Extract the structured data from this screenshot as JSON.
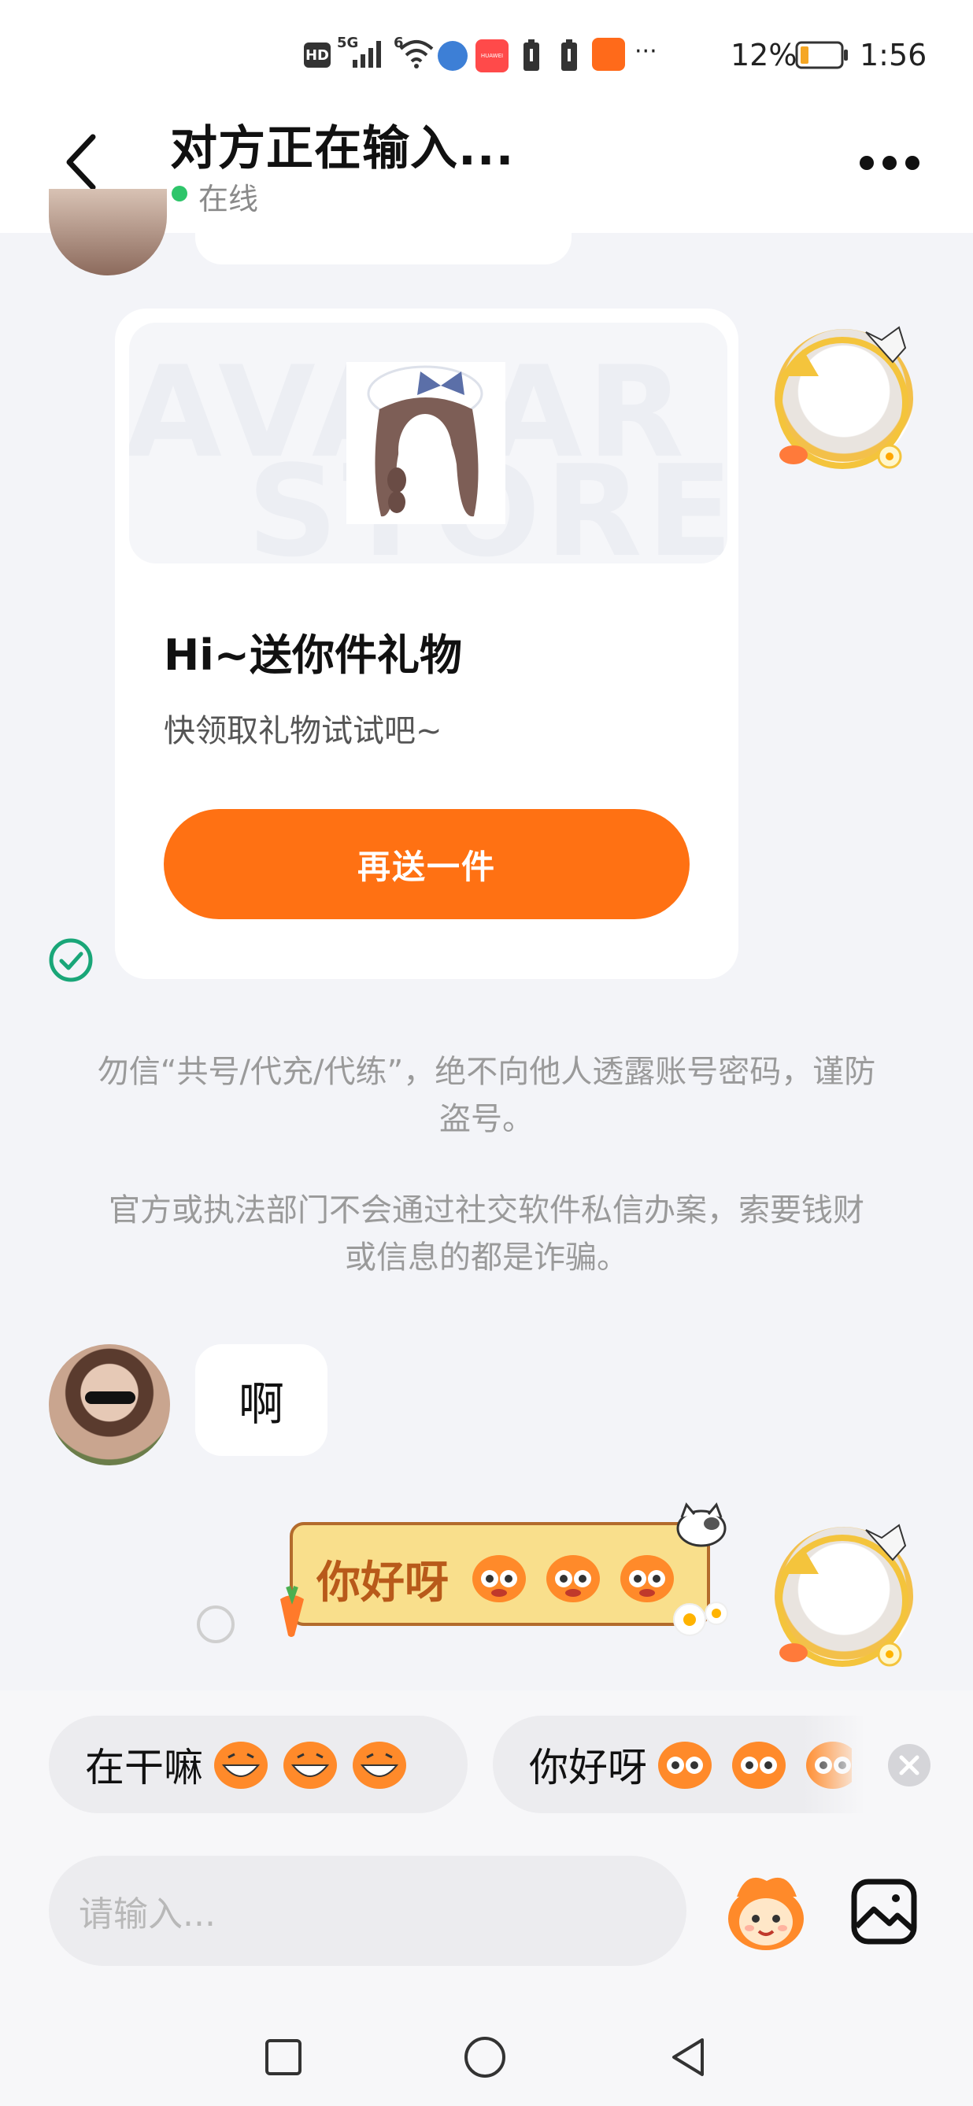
{
  "status_bar": {
    "hd": "HD",
    "network": "5G",
    "wifi_label": "6",
    "battery_percent": "12%",
    "time": "1:56",
    "more": "···",
    "app_badge": "HUAWEI"
  },
  "header": {
    "title": "对方正在输入...",
    "status": "在线"
  },
  "gift_card": {
    "banner_text_1": "AVATAR",
    "banner_text_2": "STORE",
    "title": "Hi~送你件礼物",
    "subtitle": "快领取礼物试试吧~",
    "button": "再送一件"
  },
  "notices": [
    "勿信“共号/代充/代练”，绝不向他人透露账号密码，谨防盗号。",
    "官方或执法部门不会通过社交软件私信办案，索要钱财或信息的都是诈骗。"
  ],
  "messages": {
    "incoming_text": "啊",
    "outgoing_sticker_text": "你好呀"
  },
  "quick_replies": [
    {
      "label": "在干嘛"
    },
    {
      "label": "你好呀"
    }
  ],
  "input": {
    "placeholder": "请输入..."
  },
  "colors": {
    "accent": "#ff7113",
    "online": "#2ec56a",
    "read_check": "#19a678"
  },
  "icons": {
    "back": "back-arrow-icon",
    "more": "more-dots-icon",
    "sticker": "sticker-face-icon",
    "image": "image-gallery-icon",
    "close": "close-circle-icon"
  }
}
